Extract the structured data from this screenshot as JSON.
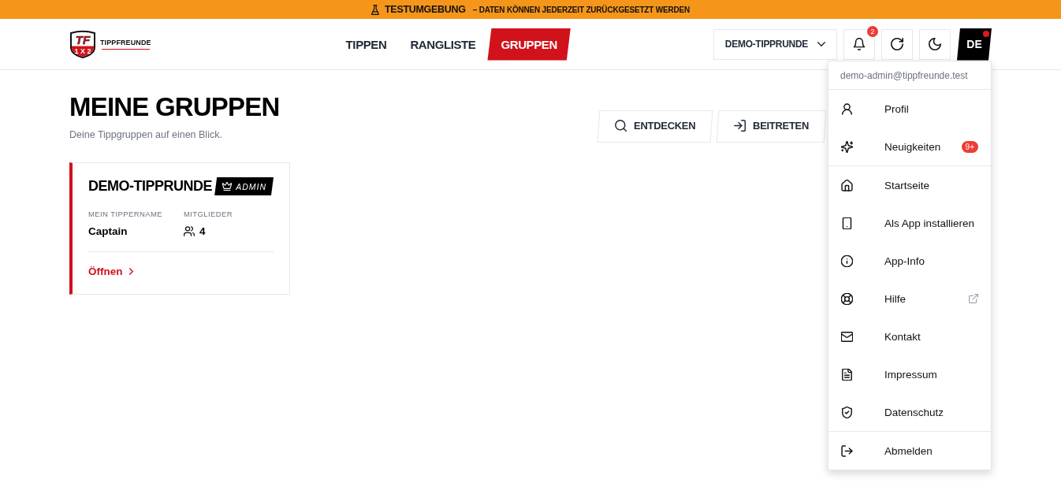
{
  "banner": {
    "title": "TESTUMGEBUNG",
    "message": "– DATEN KÖNNEN JEDERZEIT ZURÜCKGESETZT WERDEN"
  },
  "logo": {
    "initials": "TF",
    "tiles": [
      "1",
      "X",
      "2"
    ],
    "name": "TIPPFREUNDE"
  },
  "nav": [
    {
      "label": "TIPPEN",
      "selected": false
    },
    {
      "label": "RANGLISTE",
      "selected": false
    },
    {
      "label": "GRUPPEN",
      "selected": true
    }
  ],
  "group_select": {
    "value": "DEMO-TIPPRUNDE"
  },
  "notifications": {
    "badge": "2"
  },
  "language": {
    "label": "DE",
    "alert_dot": true
  },
  "page": {
    "title": "MEINE GRUPPEN",
    "subtitle": "Deine Tippgruppen auf einen Blick.",
    "actions": [
      {
        "label": "ENTDECKEN"
      },
      {
        "label": "BEITRETEN"
      }
    ]
  },
  "groups": [
    {
      "name": "DEMO-TIPPRUNDE",
      "role": "ADMIN",
      "fields": [
        {
          "kind": "text",
          "label": "MEIN TIPPERNAME",
          "value": "Captain"
        },
        {
          "kind": "count",
          "label": "MITGLIEDER",
          "value": "4"
        }
      ],
      "link": "Öffnen"
    }
  ],
  "user_menu": {
    "email": "demo-admin@tippfreunde.test",
    "sections": [
      {
        "items": [
          {
            "label": "Profil",
            "external": false
          },
          {
            "label": "Neuigkeiten",
            "badge": "9+",
            "external": false
          }
        ]
      },
      {
        "items": [
          {
            "label": "Startseite",
            "external": false
          },
          {
            "label": "Als App installieren",
            "external": false
          },
          {
            "label": "App-Info",
            "external": false
          },
          {
            "label": "Hilfe",
            "external": true
          },
          {
            "label": "Kontakt",
            "external": false
          },
          {
            "label": "Impressum",
            "external": false
          },
          {
            "label": "Datenschutz",
            "external": false
          }
        ]
      },
      {
        "items": [
          {
            "label": "Abmelden",
            "external": false
          }
        ]
      }
    ]
  }
}
